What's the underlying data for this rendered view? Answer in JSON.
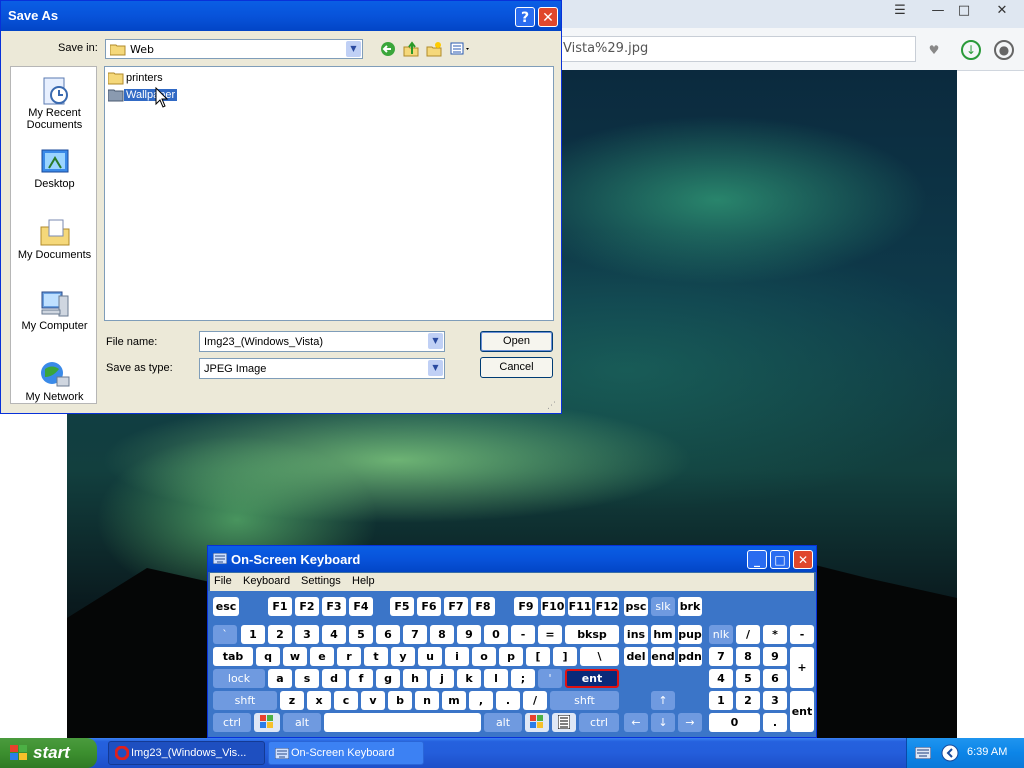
{
  "browser": {
    "address_text": "Vista%29.jpg",
    "controls": {
      "menu": "☰",
      "minimize": "—",
      "maximize": "□",
      "close": "✕"
    }
  },
  "save_dialog": {
    "title": "Save As",
    "help_glyph": "?",
    "close_glyph": "✕",
    "save_in_label": "Save in:",
    "save_in_value": "Web",
    "toolbar_icons": [
      "back-icon",
      "up-folder-icon",
      "new-folder-icon",
      "views-menu-icon"
    ],
    "places": [
      {
        "name": "my-recent-documents",
        "label_line1": "My Recent",
        "label_line2": "Documents"
      },
      {
        "name": "desktop",
        "label_line1": "Desktop",
        "label_line2": ""
      },
      {
        "name": "my-documents",
        "label_line1": "My Documents",
        "label_line2": ""
      },
      {
        "name": "my-computer",
        "label_line1": "My Computer",
        "label_line2": ""
      },
      {
        "name": "my-network",
        "label_line1": "My Network",
        "label_line2": ""
      }
    ],
    "files": [
      {
        "name": "printers",
        "selected": false
      },
      {
        "name": "Wallpaper",
        "selected": true
      }
    ],
    "file_name_label": "File name:",
    "file_name_value": "Img23_(Windows_Vista)",
    "save_type_label": "Save as type:",
    "save_type_value": "JPEG Image",
    "open_button": "Open",
    "cancel_button": "Cancel"
  },
  "keyboard": {
    "title": "On-Screen Keyboard",
    "menus": [
      "File",
      "Keyboard",
      "Settings",
      "Help"
    ],
    "row1": [
      "esc",
      "F1",
      "F2",
      "F3",
      "F4",
      "F5",
      "F6",
      "F7",
      "F8",
      "F9",
      "F10",
      "F11",
      "F12",
      "psc",
      "slk",
      "brk"
    ],
    "row2": [
      "`",
      "1",
      "2",
      "3",
      "4",
      "5",
      "6",
      "7",
      "8",
      "9",
      "0",
      "-",
      "=",
      "bksp",
      "ins",
      "hm",
      "pup",
      "nlk",
      "/",
      "*",
      "-"
    ],
    "row3": [
      "tab",
      "q",
      "w",
      "e",
      "r",
      "t",
      "y",
      "u",
      "i",
      "o",
      "p",
      "[",
      "]",
      "\\",
      "del",
      "end",
      "pdn",
      "7",
      "8",
      "9",
      "+"
    ],
    "row4": [
      "lock",
      "a",
      "s",
      "d",
      "f",
      "g",
      "h",
      "j",
      "k",
      "l",
      ";",
      "'",
      "ent",
      "4",
      "5",
      "6"
    ],
    "row5": [
      "shft",
      "z",
      "x",
      "c",
      "v",
      "b",
      "n",
      "m",
      ",",
      ".",
      "/",
      "shft",
      "↑",
      "1",
      "2",
      "3",
      "ent"
    ],
    "row6": [
      "ctrl",
      "alt",
      "",
      "alt",
      "ctrl",
      "←",
      "↓",
      "→",
      "0",
      "."
    ]
  },
  "taskbar": {
    "start_label": "start",
    "tasks": [
      {
        "label": "Img23_(Windows_Vis...",
        "icon": "opera-icon"
      },
      {
        "label": "On-Screen Keyboard",
        "icon": "keyboard-icon"
      }
    ],
    "clock": "6:39 AM"
  }
}
